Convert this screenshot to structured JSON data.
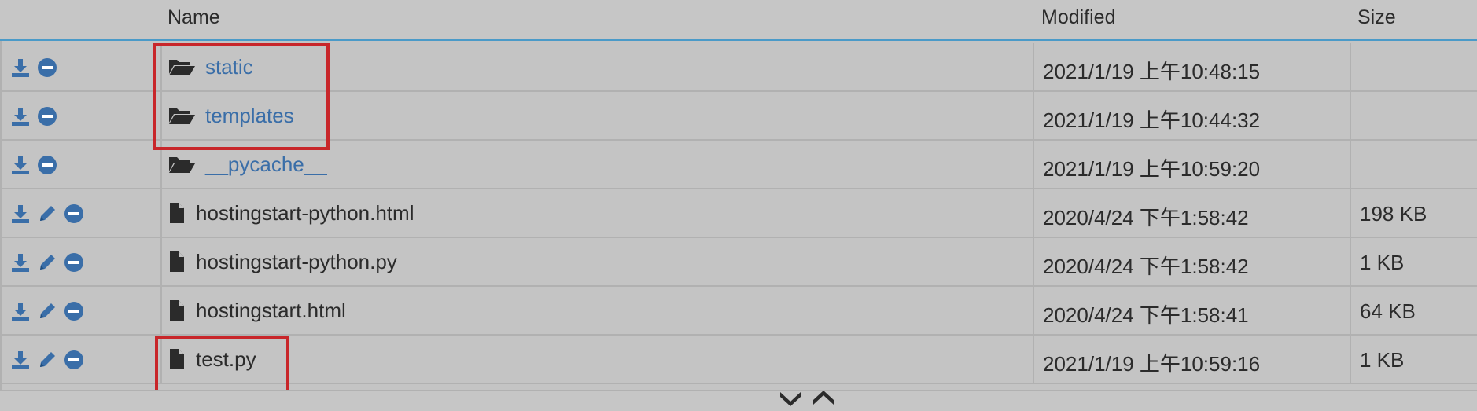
{
  "header": {
    "name": "Name",
    "modified": "Modified",
    "size": "Size"
  },
  "colors": {
    "accent": "#4a9ac8",
    "link": "#3a6ea8",
    "icon": "#3a6ea8",
    "highlight": "#c8262a"
  },
  "rows": [
    {
      "type": "folder",
      "name": "static",
      "modified": "2021/1/19 上午10:48:15",
      "size": "",
      "editable": false
    },
    {
      "type": "folder",
      "name": "templates",
      "modified": "2021/1/19 上午10:44:32",
      "size": "",
      "editable": false
    },
    {
      "type": "folder",
      "name": "__pycache__",
      "modified": "2021/1/19 上午10:59:20",
      "size": "",
      "editable": false
    },
    {
      "type": "file",
      "name": "hostingstart-python.html",
      "modified": "2020/4/24 下午1:58:42",
      "size": "198 KB",
      "editable": true
    },
    {
      "type": "file",
      "name": "hostingstart-python.py",
      "modified": "2020/4/24 下午1:58:42",
      "size": "1 KB",
      "editable": true
    },
    {
      "type": "file",
      "name": "hostingstart.html",
      "modified": "2020/4/24 下午1:58:41",
      "size": "64 KB",
      "editable": true
    },
    {
      "type": "file",
      "name": "test.py",
      "modified": "2021/1/19 上午10:59:16",
      "size": "1 KB",
      "editable": true
    }
  ],
  "icons": {
    "download": "download-icon",
    "edit": "pencil-icon",
    "delete": "minus-circle-icon",
    "folder": "folder-open-icon",
    "file": "file-icon",
    "collapse": "chevron-down-icon",
    "expand": "chevron-up-icon"
  }
}
